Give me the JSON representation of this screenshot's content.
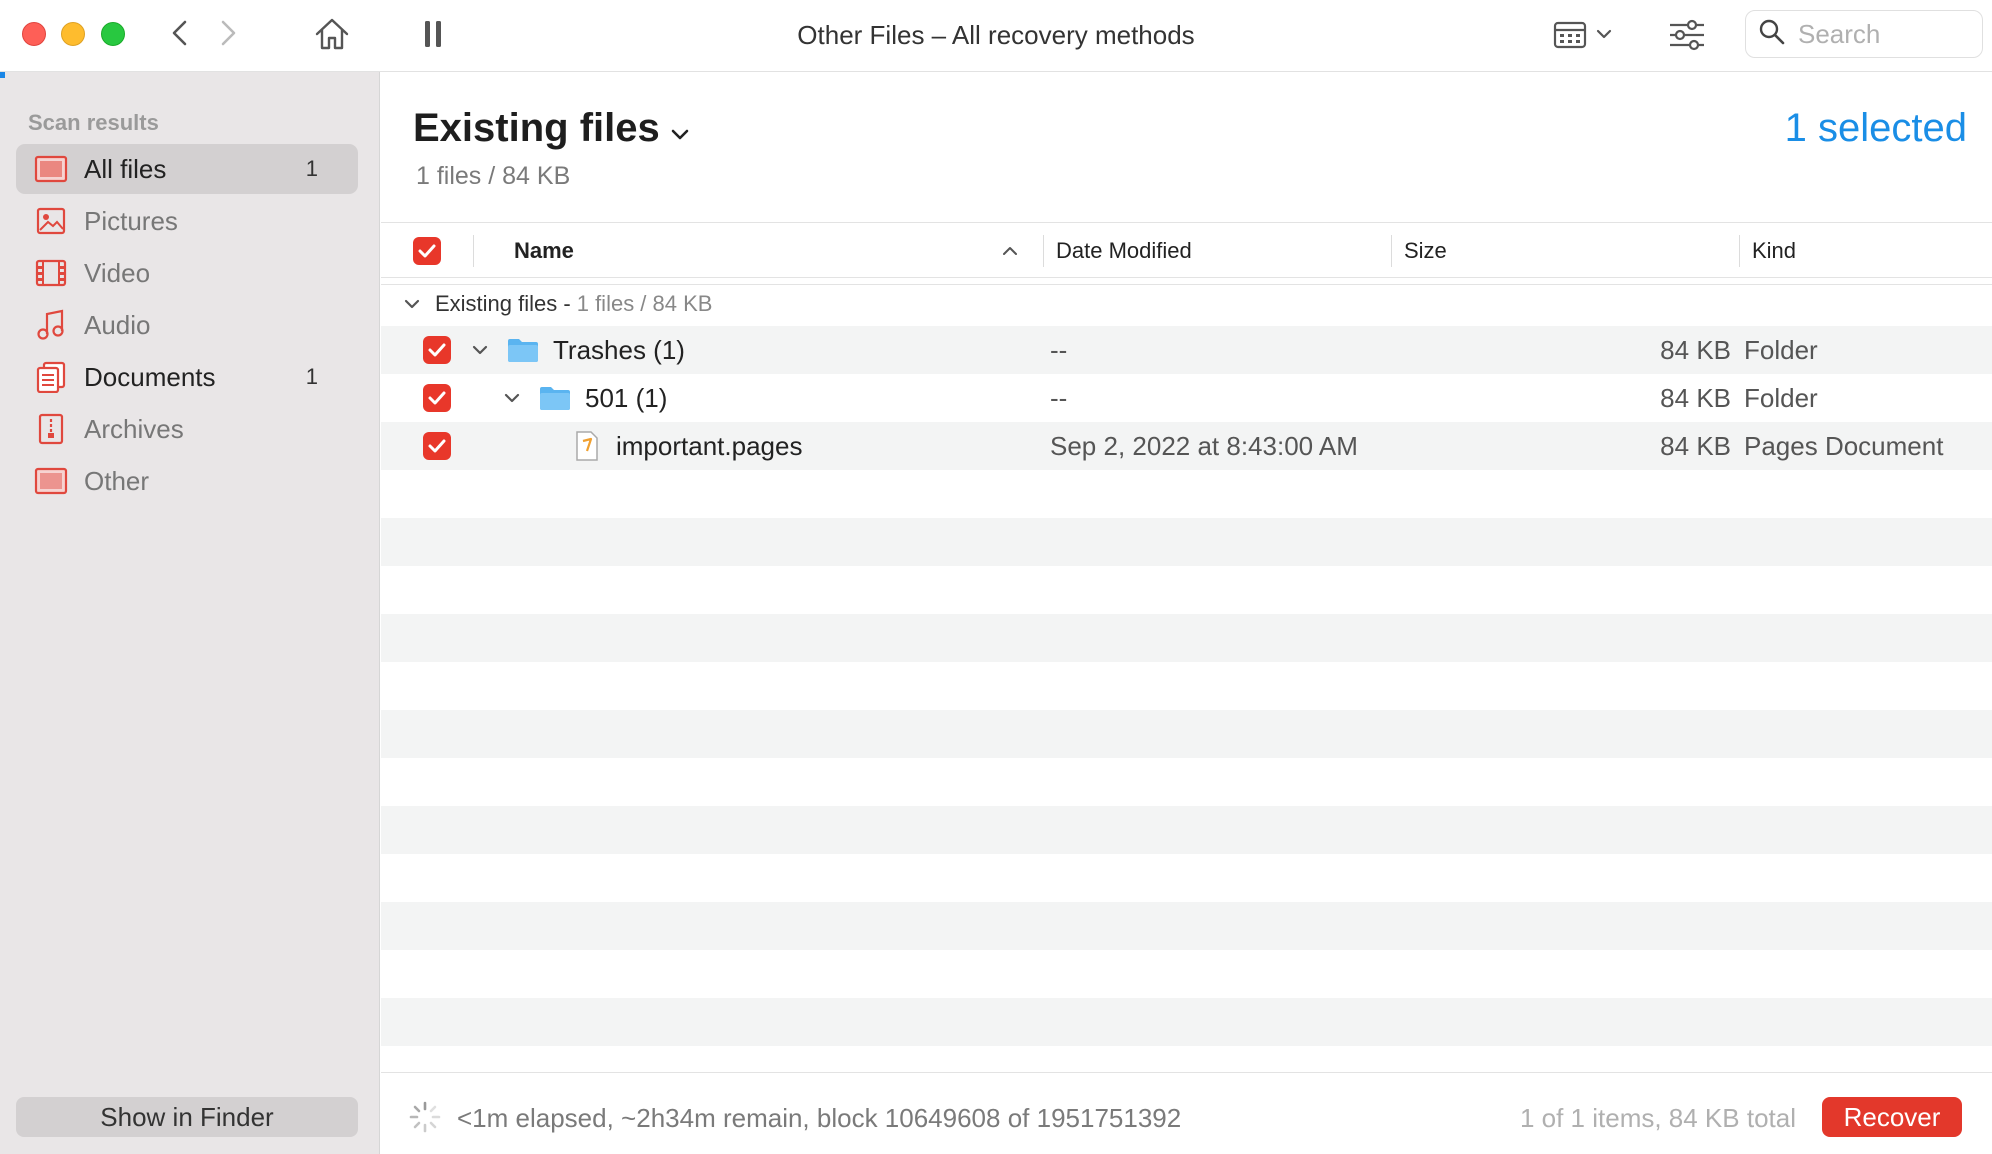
{
  "window": {
    "title": "Other Files – All recovery methods",
    "search_placeholder": "Search"
  },
  "sidebar": {
    "header": "Scan results",
    "items": [
      {
        "label": "All files",
        "count": "1",
        "icon": "all-files-icon"
      },
      {
        "label": "Pictures",
        "count": "",
        "icon": "pictures-icon"
      },
      {
        "label": "Video",
        "count": "",
        "icon": "video-icon"
      },
      {
        "label": "Audio",
        "count": "",
        "icon": "audio-icon"
      },
      {
        "label": "Documents",
        "count": "1",
        "icon": "documents-icon"
      },
      {
        "label": "Archives",
        "count": "",
        "icon": "archives-icon"
      },
      {
        "label": "Other",
        "count": "",
        "icon": "other-icon"
      }
    ],
    "show_in_finder": "Show in Finder"
  },
  "main": {
    "title": "Existing files",
    "subtitle": "1 files / 84 KB",
    "selected": "1 selected",
    "columns": {
      "name": "Name",
      "date": "Date Modified",
      "size": "Size",
      "kind": "Kind"
    },
    "group": {
      "name": "Existing files -",
      "info": "1 files / 84 KB"
    },
    "rows": [
      {
        "name": "Trashes (1)",
        "date": "--",
        "size": "84 KB",
        "kind": "Folder"
      },
      {
        "name": "501 (1)",
        "date": "--",
        "size": "84 KB",
        "kind": "Folder"
      },
      {
        "name": "important.pages",
        "date": "Sep 2, 2022 at 8:43:00 AM",
        "size": "84 KB",
        "kind": "Pages Document"
      }
    ]
  },
  "footer": {
    "status": "<1m elapsed, ~2h34m remain, block 10649608 of 1951751392",
    "summary": "1 of 1 items, 84 KB total",
    "recover": "Recover"
  },
  "colors": {
    "accent_blue": "#1a8ee6",
    "recover_red": "#e3382b",
    "checkbox_red": "#e8372a",
    "icon_red": "#e0483e",
    "folder_blue": "#5ab4f0"
  }
}
